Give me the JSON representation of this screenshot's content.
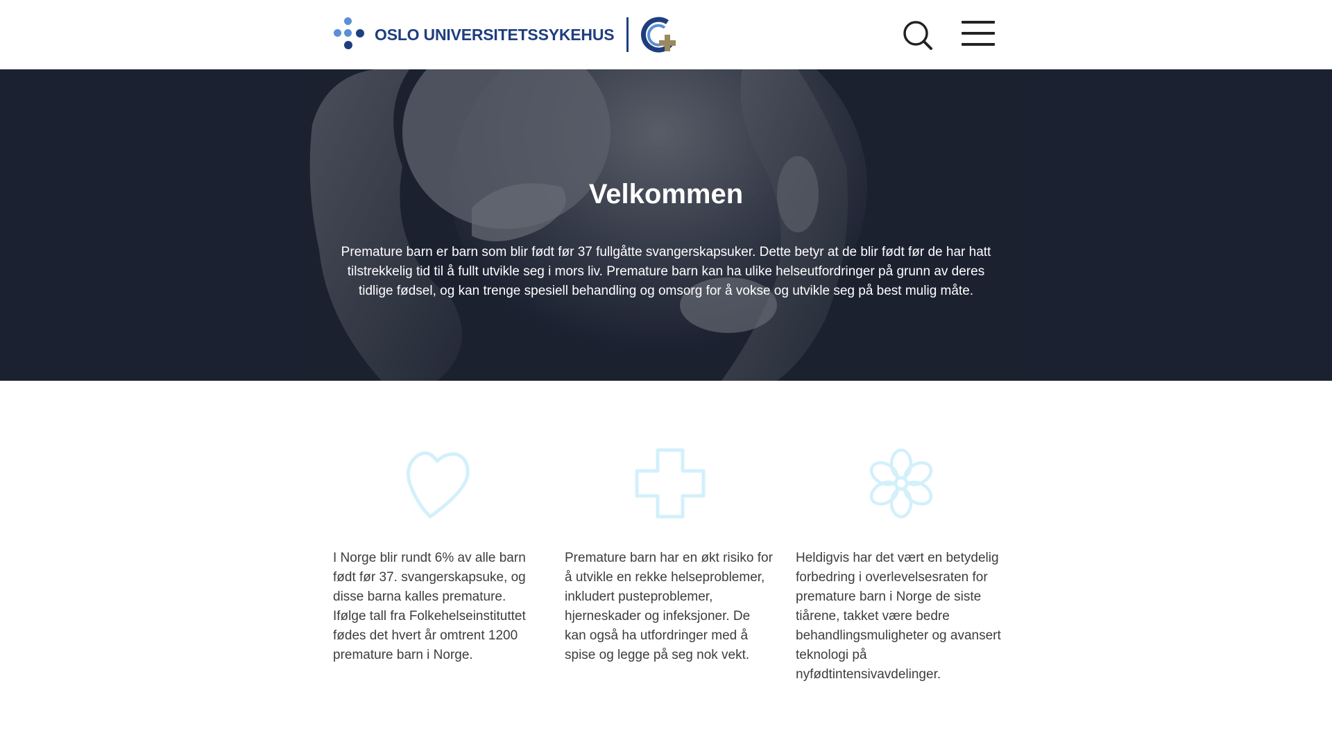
{
  "header": {
    "logo_text": "OSLO UNIVERSITETSSYKEHUS",
    "search_icon": "search-icon",
    "menu_icon": "hamburger-menu-icon"
  },
  "hero": {
    "title": "Velkommen",
    "text": "Premature barn er barn som blir født før 37 fullgåtte svangerskapsuker. Dette betyr at de blir født før de har hatt tilstrekkelig tid til å fullt utvikle seg i mors liv. Premature barn kan ha ulike helseutfordringer på grunn av deres tidlige fødsel, og kan trenge spesiell behandling og omsorg for å vokse og utvikle seg på best mulig måte."
  },
  "features": [
    {
      "icon": "heart-icon",
      "text": "I Norge blir rundt 6% av alle barn født før 37. svangerskapsuke, og disse barna kalles premature. Ifølge tall fra Folkehelseinstituttet fødes det hvert år omtrent 1200 premature barn i Norge."
    },
    {
      "icon": "medical-cross-icon",
      "text": "Premature barn har en økt risiko for å utvikle en rekke helseproblemer, inkludert pusteproblemer, hjerneskader og infeksjoner. De kan også ha utfordringer med å spise og legge på seg nok vekt."
    },
    {
      "icon": "flower-icon",
      "text": "Heldigvis har det vært en betydelig forbedring i overlevelsesraten for premature barn i Norge de siste tiårene, takket være bedre behandlingsmuligheter og avansert teknologi på nyfødtintensivavdelinger."
    }
  ],
  "colors": {
    "brand_blue": "#1f3e7e",
    "hero_bg": "#1c2131",
    "icon_light_blue": "#d3f0fb"
  }
}
